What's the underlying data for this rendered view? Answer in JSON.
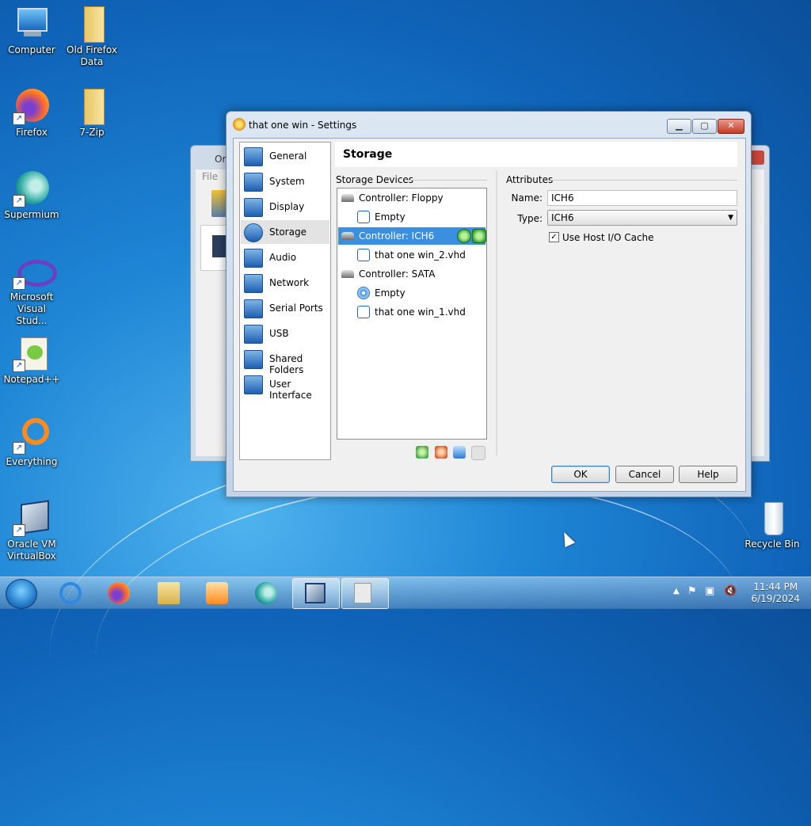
{
  "desktop": {
    "icons": [
      {
        "label": "Computer"
      },
      {
        "label": "Old Firefox Data"
      },
      {
        "label": "Firefox"
      },
      {
        "label": "7-Zip"
      },
      {
        "label": "Supermium"
      },
      {
        "label": "Microsoft Visual Stud..."
      },
      {
        "label": "Notepad++"
      },
      {
        "label": "Everything"
      },
      {
        "label": "Oracle VM VirtualBox"
      },
      {
        "label": "Recycle Bin"
      }
    ]
  },
  "background_window": {
    "title": "Ora",
    "menu_file": "File"
  },
  "dialog": {
    "title": "that one win - Settings",
    "categories": [
      {
        "label": "General"
      },
      {
        "label": "System"
      },
      {
        "label": "Display"
      },
      {
        "label": "Storage"
      },
      {
        "label": "Audio"
      },
      {
        "label": "Network"
      },
      {
        "label": "Serial Ports"
      },
      {
        "label": "USB"
      },
      {
        "label": "Shared Folders"
      },
      {
        "label": "User Interface"
      }
    ],
    "selected_category": "Storage",
    "page_title": "Storage",
    "storage_devices_label": "Storage Devices",
    "attributes_label": "Attributes",
    "tree": [
      {
        "label": "Controller: Floppy"
      },
      {
        "label": "Empty"
      },
      {
        "label": "Controller: ICH6"
      },
      {
        "label": "that one win_2.vhd"
      },
      {
        "label": "Controller: SATA"
      },
      {
        "label": "Empty"
      },
      {
        "label": "that one win_1.vhd"
      }
    ],
    "attributes": {
      "name_label": "Name:",
      "name_value": "ICH6",
      "type_label": "Type:",
      "type_value": "ICH6",
      "cache_label": "Use Host I/O Cache",
      "cache_checked": true,
      "check_mark": "✓"
    },
    "buttons": {
      "ok": "OK",
      "cancel": "Cancel",
      "help": "Help"
    }
  },
  "taskbar": {
    "time": "11:44 PM",
    "date": "6/19/2024"
  },
  "colors": {
    "selection": "#3a8fe0",
    "accent": "#1e67b8"
  }
}
